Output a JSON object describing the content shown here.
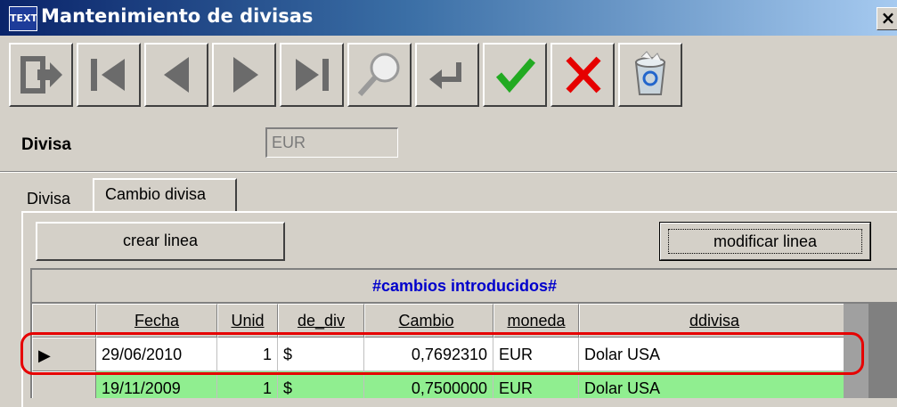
{
  "window": {
    "title": "Mantenimiento de divisas",
    "app_icon_text": "TEXT",
    "close_label": "×"
  },
  "toolbar": {
    "buttons": [
      {
        "name": "exit-button",
        "icon": "exit-icon"
      },
      {
        "name": "first-record-button",
        "icon": "first-icon"
      },
      {
        "name": "previous-record-button",
        "icon": "previous-icon"
      },
      {
        "name": "next-record-button",
        "icon": "next-icon"
      },
      {
        "name": "last-record-button",
        "icon": "last-icon"
      },
      {
        "name": "search-button",
        "icon": "search-icon"
      },
      {
        "name": "return-button",
        "icon": "return-icon"
      },
      {
        "name": "accept-button",
        "icon": "check-icon",
        "color": "#22aa22"
      },
      {
        "name": "cancel-button",
        "icon": "cross-icon",
        "color": "#e60000"
      },
      {
        "name": "recycle-button",
        "icon": "recycle-bin-icon"
      }
    ]
  },
  "form": {
    "divisa_label": "Divisa",
    "divisa_value": "EUR"
  },
  "tabs": [
    {
      "label": "Divisa",
      "active": false
    },
    {
      "label": "Cambio divisa",
      "active": true
    }
  ],
  "panel": {
    "create_button": "crear linea",
    "modify_button": "modificar linea",
    "grid_title": "#cambios introducidos#"
  },
  "grid": {
    "columns": [
      "",
      "Fecha",
      "Unid",
      "de_div",
      "Cambio",
      "moneda",
      "ddivisa"
    ],
    "rows": [
      {
        "indicator": "▶",
        "fecha": "29/06/2010",
        "unid": "1",
        "de_div": "$",
        "cambio": "0,7692310",
        "moneda": "EUR",
        "ddivisa": "Dolar USA",
        "selected": true
      },
      {
        "indicator": "",
        "fecha": "19/11/2009",
        "unid": "1",
        "de_div": "$",
        "cambio": "0,7500000",
        "moneda": "EUR",
        "ddivisa": "Dolar USA",
        "selected": false
      }
    ]
  },
  "colors": {
    "title_bar_start": "#0a246a",
    "grid_title": "#0000cc",
    "highlight": "#e60000",
    "row_green": "#90ee90"
  }
}
